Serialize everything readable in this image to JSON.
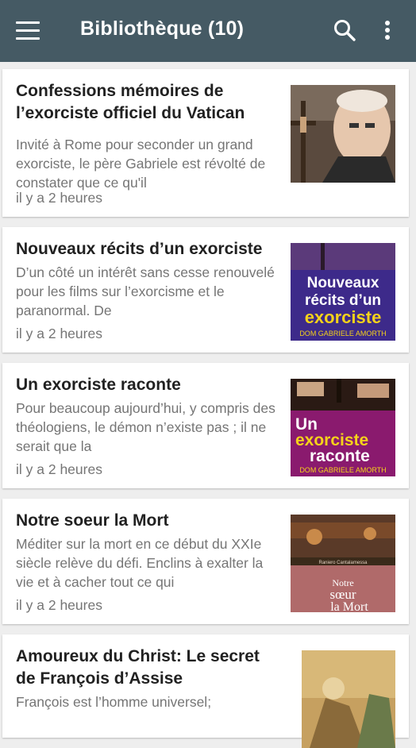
{
  "appbar": {
    "title": "Bibliothèque (10)",
    "menu_icon": "hamburger-menu-icon",
    "search_icon": "search-icon",
    "more_icon": "more-vert-icon",
    "color": "#455a64"
  },
  "books": [
    {
      "title": "Confessions mémoires de l’exorciste officiel du Vatican",
      "excerpt": "Invité à Rome pour seconder un grand exorciste, le père Gabriele est révolté de constater que ce qu'il",
      "time": "il y a 2 heures"
    },
    {
      "title": "Nouveaux récits d’un exorciste",
      "excerpt": "D’un côté un intérêt sans cesse renouvelé pour les films sur l’exorcisme et le paranormal. De",
      "time": "il y a 2 heures",
      "cover": {
        "line1": "Nouveaux",
        "line2": "récits d’un",
        "line3": "exorciste",
        "author": "DOM GABRIELE AMORTH"
      }
    },
    {
      "title": "Un exorciste raconte",
      "excerpt": "Pour beaucoup aujourd’hui, y compris des théologiens, le démon n’existe pas ; il ne serait que la",
      "time": "il y a 2 heures",
      "cover": {
        "line1": "Un",
        "line2": "exorciste",
        "line3": "raconte",
        "author": "DOM GABRIELE AMORTH"
      }
    },
    {
      "title": "Notre soeur la Mort",
      "excerpt": "Méditer sur la mort en ce début du XXIe siècle relève du défi. Enclins à exalter la vie et à cacher tout ce qui",
      "time": "il y a 2 heures",
      "cover": {
        "author": "Raniero Cantalamessa",
        "line1": "Notre",
        "line2": "sœur",
        "line3": "la Mort"
      }
    },
    {
      "title": "Amoureux du Christ: Le secret de François d’Assise",
      "excerpt": "François est l’homme universel;",
      "time": ""
    }
  ]
}
